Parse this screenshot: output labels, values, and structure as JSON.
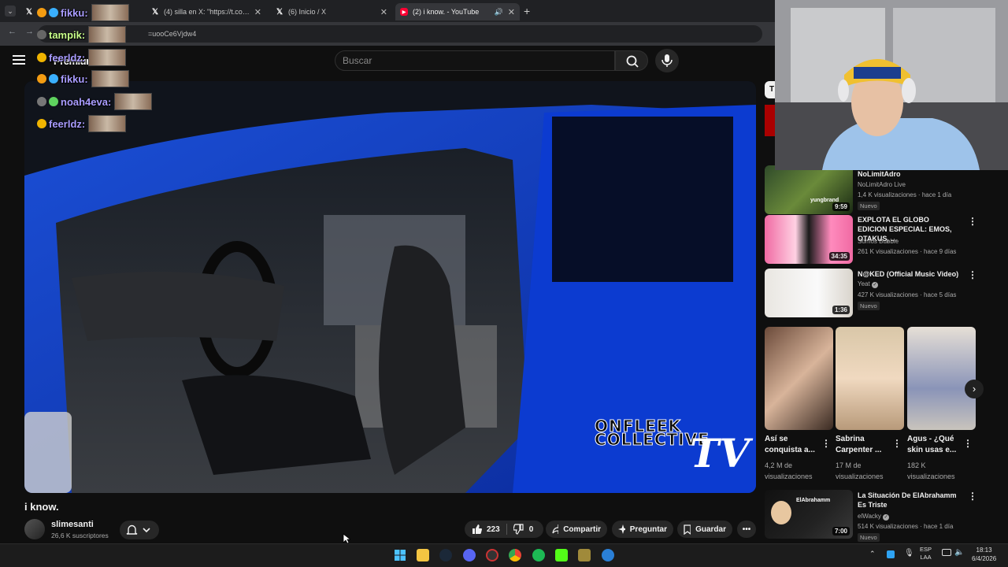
{
  "browser": {
    "tabs": [
      {
        "title": "",
        "icon": "x-logo"
      },
      {
        "title": "(4) silla en X: \"https://t.co/7Mpl",
        "icon": "x-logo"
      },
      {
        "title": "(6) Inicio / X",
        "icon": "x-logo"
      },
      {
        "title": "(2) i know. - YouTube",
        "icon": "youtube-logo",
        "active": true
      }
    ],
    "url": "=uooCe6Vjdw4"
  },
  "youtube": {
    "premium_label": "Premium",
    "search_placeholder": "Buscar",
    "video": {
      "watermark_line1": "ONFLEEK",
      "watermark_line2": "COLLECTIVE",
      "watermark_tv": "TV",
      "title": "i know.",
      "channel": "slimesanti",
      "subscribers": "26,6 K suscriptores",
      "likes": "223",
      "dislikes": "0",
      "share_label": "Compartir",
      "ask_label": "Preguntar",
      "save_label": "Guardar"
    },
    "sidebar": {
      "videos": [
        {
          "title": "NoLimitAdro",
          "channel": "NoLimitAdro Live",
          "meta": "1,4 K visualizaciones · hace 1 día",
          "badge": "Nuevo",
          "duration": "9:59",
          "thumb_text": "yungbrand"
        },
        {
          "title": "EXPLOTA EL GLOBO EDICION ESPECIAL: EMOS, OTAKUS, ...",
          "channel": "Somos Bubble",
          "meta": "261 K visualizaciones · hace 9 días",
          "badge": "",
          "duration": "34:35"
        },
        {
          "title": "N@KED (Official Music Video)",
          "channel": "Yeat",
          "meta": "427 K visualizaciones · hace 5 días",
          "badge": "Nuevo",
          "duration": "1:36"
        },
        {
          "title": "La Situación De ElAbrahamm Es Triste",
          "channel": "elWacky",
          "meta": "514 K visualizaciones · hace 1 día",
          "badge": "Nuevo",
          "duration": "7:00",
          "thumb_text": "ElAbrahamm"
        }
      ],
      "shorts": [
        {
          "title": "Así se conquista a...",
          "views": "4,2 M de visualizaciones"
        },
        {
          "title": "Sabrina Carpenter ...",
          "views": "17 M de visualizaciones"
        },
        {
          "title": "Agus - ¿Qué skin usas e...",
          "views": "182 K visualizaciones"
        }
      ]
    }
  },
  "chat": [
    {
      "name": "fikku:",
      "top": true
    },
    {
      "name": "tampik:"
    },
    {
      "name": "feerldz:"
    },
    {
      "name": "fikku:"
    },
    {
      "name": "noah4eva:"
    },
    {
      "name": "feerldz:"
    }
  ],
  "taskbar": {
    "lang_line1": "ESP",
    "lang_line2": "LAA",
    "time": "18:13",
    "date": "6/4/2026"
  },
  "colors": {
    "youtube_red": "#ff0033",
    "chat_name": "#a99cff"
  }
}
